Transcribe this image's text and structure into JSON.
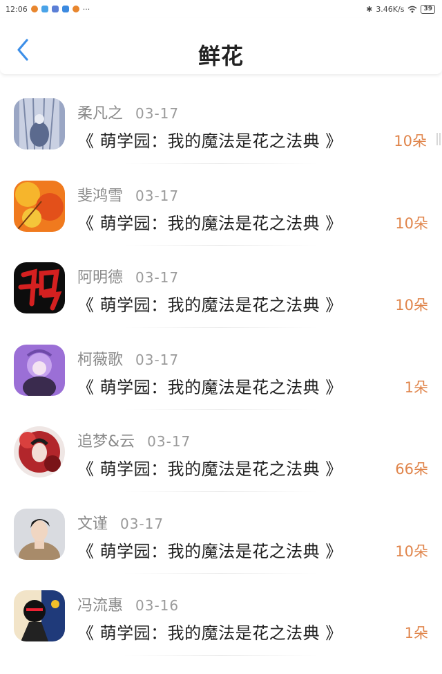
{
  "status_bar": {
    "time": "12:06",
    "network_speed": "3.46K/s",
    "battery": "39"
  },
  "header": {
    "title": "鲜花",
    "back_icon": "chevron-left-icon"
  },
  "accent_color": "#3d8fe8",
  "amount_color": "#e0844a",
  "items": [
    {
      "name": "柔凡之",
      "date": "03-17",
      "book": "《 萌学园：我的魔法是花之法典 》",
      "amount": "10朵"
    },
    {
      "name": "斐鸿雪",
      "date": "03-17",
      "book": "《 萌学园：我的魔法是花之法典 》",
      "amount": "10朵"
    },
    {
      "name": "阿明德",
      "date": "03-17",
      "book": "《 萌学园：我的魔法是花之法典 》",
      "amount": "10朵"
    },
    {
      "name": "柯薇歌",
      "date": "03-17",
      "book": "《 萌学园：我的魔法是花之法典 》",
      "amount": "1朵"
    },
    {
      "name": "追梦&云",
      "date": "03-17",
      "book": "《 萌学园：我的魔法是花之法典 》",
      "amount": "66朵"
    },
    {
      "name": "文谨",
      "date": "03-17",
      "book": "《 萌学园：我的魔法是花之法典 》",
      "amount": "10朵"
    },
    {
      "name": "冯流惠",
      "date": "03-16",
      "book": "《 萌学园：我的魔法是花之法典 》",
      "amount": "1朵"
    }
  ]
}
